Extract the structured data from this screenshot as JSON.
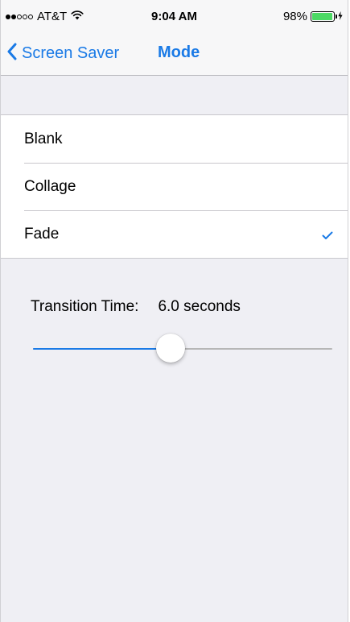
{
  "status_bar": {
    "signal_bars_filled": 2,
    "signal_bars_total": 5,
    "carrier": "AT&T",
    "time": "9:04 AM",
    "battery_percent_label": "98%",
    "battery_level": 0.98,
    "icons": [
      "wifi-icon",
      "charging-bolt-icon"
    ]
  },
  "nav": {
    "back_label": "Screen Saver",
    "back_icon": "chevron-left-icon",
    "title": "Mode"
  },
  "options": [
    {
      "label": "Blank",
      "selected": false
    },
    {
      "label": "Collage",
      "selected": false
    },
    {
      "label": "Fade",
      "selected": true,
      "icon": "checkmark-icon"
    }
  ],
  "transition": {
    "label": "Transition Time:",
    "value": "6.0 seconds",
    "slider_level": 0.46
  },
  "colors": {
    "accent": "#1a7ae6",
    "battery_green": "#4cd964",
    "background": "#efeff4",
    "bar_background": "#f7f7f8"
  }
}
